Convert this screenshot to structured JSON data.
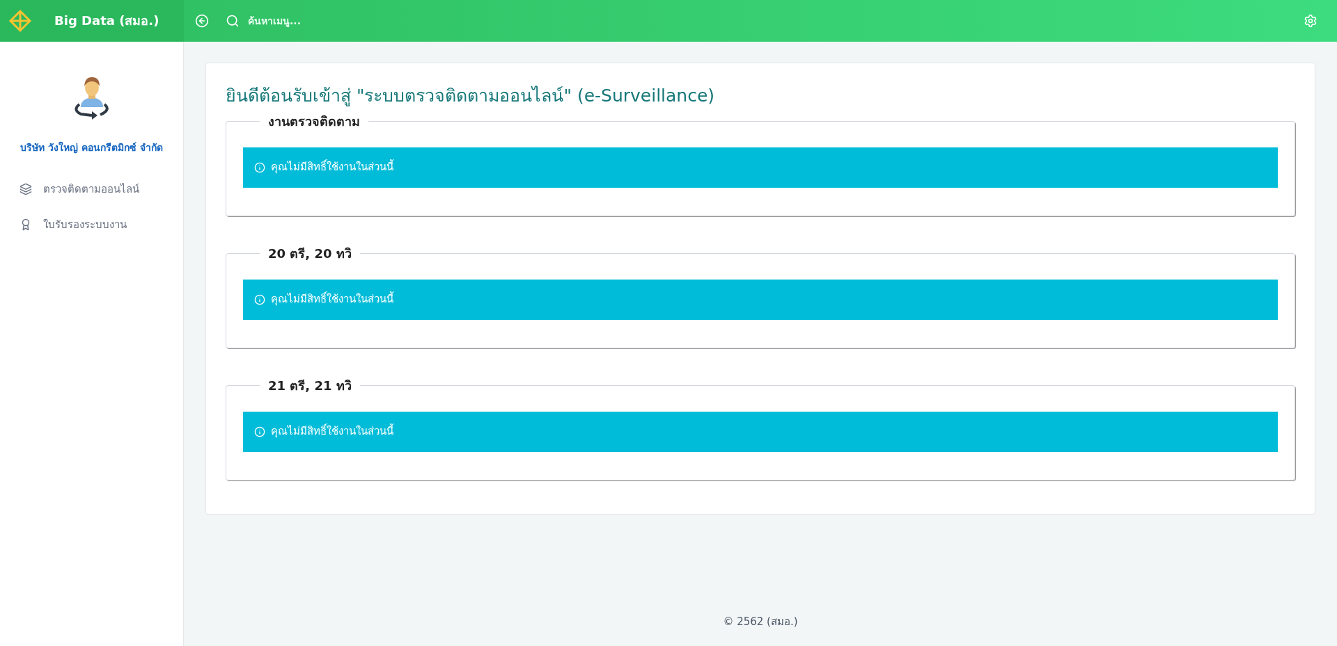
{
  "header": {
    "brand": "Big Data (สมอ.)",
    "search": {
      "placeholder": "ค้นหาเมนู..."
    }
  },
  "sidebar": {
    "company": "บริษัท วังใหญ่ คอนกรีตมิกซ์ จำกัด",
    "items": [
      {
        "label": "ตรวจติดตามออนไลน์",
        "kind": "layers"
      },
      {
        "label": "ใบรับรองระบบงาน",
        "kind": "award"
      }
    ]
  },
  "page": {
    "title": "ยินดีต้อนรับเข้าสู่ \"ระบบตรวจติดตามออนไลน์\" (e-Surveillance)",
    "sections": [
      {
        "legend": "งานตรวจติดตาม",
        "alert": "คุณไม่มีสิทธิ์ใช้งานในส่วนนี้"
      },
      {
        "legend": "20 ตรี, 20 ทวิ",
        "alert": "คุณไม่มีสิทธิ์ใช้งานในส่วนนี้"
      },
      {
        "legend": "21 ตรี, 21 ทวิ",
        "alert": "คุณไม่มีสิทธิ์ใช้งานในส่วนนี้"
      }
    ]
  },
  "footer": "© 2562 (สมอ.)"
}
